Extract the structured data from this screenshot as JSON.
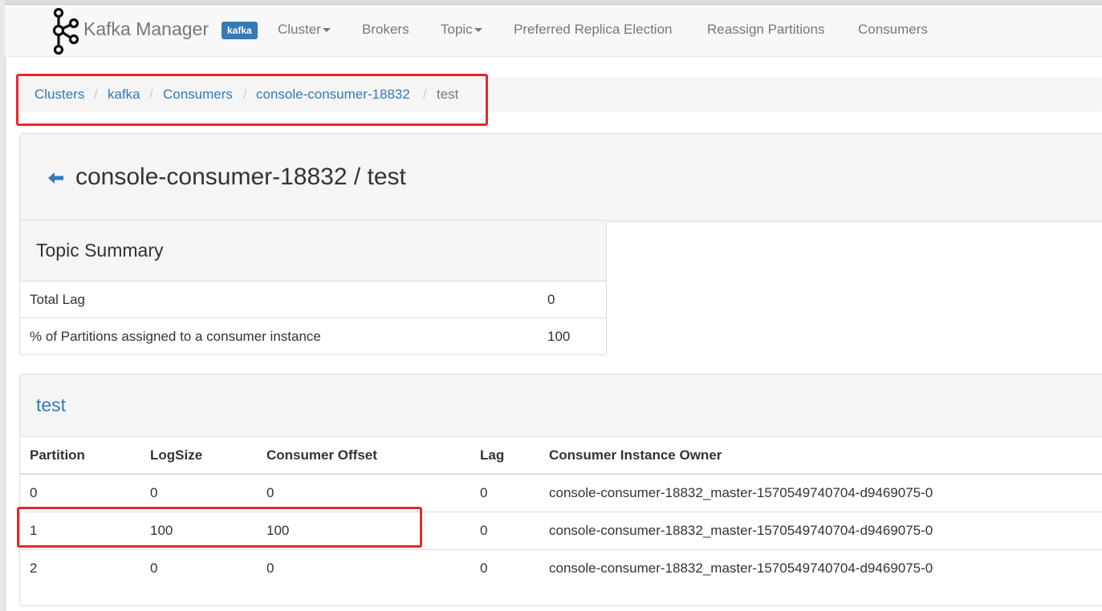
{
  "navbar": {
    "brand": "Kafka Manager",
    "cluster_badge": "kafka",
    "items": [
      {
        "label": "Cluster",
        "dropdown": true
      },
      {
        "label": "Brokers",
        "dropdown": false
      },
      {
        "label": "Topic",
        "dropdown": true
      },
      {
        "label": "Preferred Replica Election",
        "dropdown": false
      },
      {
        "label": "Reassign Partitions",
        "dropdown": false
      },
      {
        "label": "Consumers",
        "dropdown": false
      }
    ]
  },
  "breadcrumb": [
    "Clusters",
    "kafka",
    "Consumers",
    "console-consumer-18832",
    "test"
  ],
  "page": {
    "title": "console-consumer-18832 / test",
    "back_icon": "arrow-left-icon"
  },
  "summary": {
    "title": "Topic Summary",
    "rows": [
      {
        "label": "Total Lag",
        "value": "0"
      },
      {
        "label": "% of Partitions assigned to a consumer instance",
        "value": "100"
      }
    ]
  },
  "topic_table": {
    "title": "test",
    "headers": [
      "Partition",
      "LogSize",
      "Consumer Offset",
      "Lag",
      "Consumer Instance Owner"
    ],
    "rows": [
      [
        "0",
        "0",
        "0",
        "0",
        "console-consumer-18832_master-1570549740704-d9469075-0"
      ],
      [
        "1",
        "100",
        "100",
        "0",
        "console-consumer-18832_master-1570549740704-d9469075-0"
      ],
      [
        "2",
        "0",
        "0",
        "0",
        "console-consumer-18832_master-1570549740704-d9469075-0"
      ]
    ]
  },
  "colors": {
    "link": "#337ab7",
    "highlight": "#e8272a",
    "badge": "#337ab7"
  }
}
